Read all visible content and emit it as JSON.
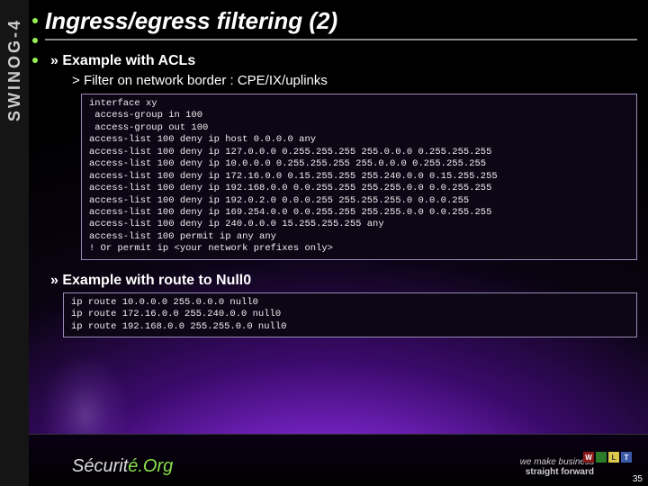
{
  "sidebar": {
    "label": "SWINOG-4"
  },
  "title": "Ingress/egress filtering (2)",
  "section1": {
    "heading": "Example with ACLs",
    "sub": "Filter on network border : CPE/IX/uplinks",
    "code": "interface xy\n access-group in 100\n access-group out 100\naccess-list 100 deny ip host 0.0.0.0 any\naccess-list 100 deny ip 127.0.0.0 0.255.255.255 255.0.0.0 0.255.255.255\naccess-list 100 deny ip 10.0.0.0 0.255.255.255 255.0.0.0 0.255.255.255\naccess-list 100 deny ip 172.16.0.0 0.15.255.255 255.240.0.0 0.15.255.255\naccess-list 100 deny ip 192.168.0.0 0.0.255.255 255.255.0.0 0.0.255.255\naccess-list 100 deny ip 192.0.2.0 0.0.0.255 255.255.255.0 0.0.0.255\naccess-list 100 deny ip 169.254.0.0 0.0.255.255 255.255.0.0 0.0.255.255\naccess-list 100 deny ip 240.0.0.0 15.255.255.255 any\naccess-list 100 permit ip any any\n! Or permit ip <your network prefixes only>"
  },
  "section2": {
    "heading": "Example with route to Null0",
    "code": "ip route 10.0.0.0 255.0.0.0 null0\nip route 172.16.0.0 255.240.0.0 null0\nip route 192.168.0.0 255.255.0.0 null0"
  },
  "footer": {
    "logo_pre": "Sécurit",
    "logo_post": "é.Org",
    "tagline1": "we make business",
    "tagline2": "straight forward",
    "squares": [
      "W",
      "",
      "L",
      "T"
    ],
    "square_colors": [
      "#8a1818",
      "#2a7a2a",
      "#d9c84a",
      "#3a5aa8"
    ],
    "page": "35"
  }
}
